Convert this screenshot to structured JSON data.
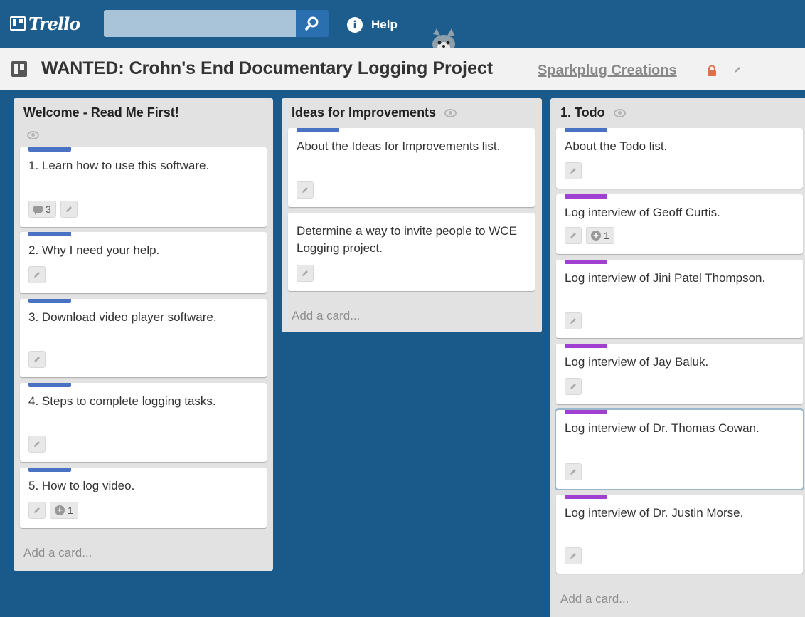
{
  "header": {
    "logo_text": "Trello",
    "search": {
      "value": "",
      "placeholder": ""
    },
    "help_label": "Help"
  },
  "board": {
    "title": "WANTED: Crohn's End Documentary Logging Project",
    "organization": "Sparkplug Creations"
  },
  "lists": [
    {
      "title": "Welcome - Read Me First!",
      "add_card": "Add a card...",
      "cards": [
        {
          "title": "1. Learn how to use this software.",
          "label_color": "#4a72c4",
          "comments": "3"
        },
        {
          "title": "2. Why I need your help.",
          "label_color": "#4a72c4"
        },
        {
          "title": "3. Download video player software.",
          "label_color": "#4a72c4"
        },
        {
          "title": "4. Steps to complete logging tasks.",
          "label_color": "#4a72c4"
        },
        {
          "title": "5. How to log video.",
          "label_color": "#4a72c4",
          "votes": "1"
        }
      ]
    },
    {
      "title": "Ideas for Improvements",
      "add_card": "Add a card...",
      "cards": [
        {
          "title": "About the Ideas for Improvements list.",
          "label_color": "#4a72c4"
        },
        {
          "title": "Determine a way to invite people to WCE Logging project."
        }
      ]
    },
    {
      "title": "1. Todo",
      "add_card": "Add a card...",
      "cards": [
        {
          "title": "About the Todo list.",
          "label_color": "#4a72c4"
        },
        {
          "title": "Log interview of Geoff Curtis.",
          "label_color": "#a040d0",
          "votes": "1"
        },
        {
          "title": "Log interview of Jini Patel Thompson.",
          "label_color": "#a040d0"
        },
        {
          "title": "Log interview of Jay Baluk.",
          "label_color": "#a040d0"
        },
        {
          "title": "Log interview of Dr. Thomas Cowan.",
          "label_color": "#a040d0"
        },
        {
          "title": "Log interview of Dr. Justin Morse.",
          "label_color": "#a040d0"
        }
      ]
    }
  ],
  "colors": {
    "header_bg": "#1d5d8e",
    "board_bg": "#1a5a8a",
    "label_blue": "#4a72c4",
    "label_purple": "#a040d0"
  }
}
